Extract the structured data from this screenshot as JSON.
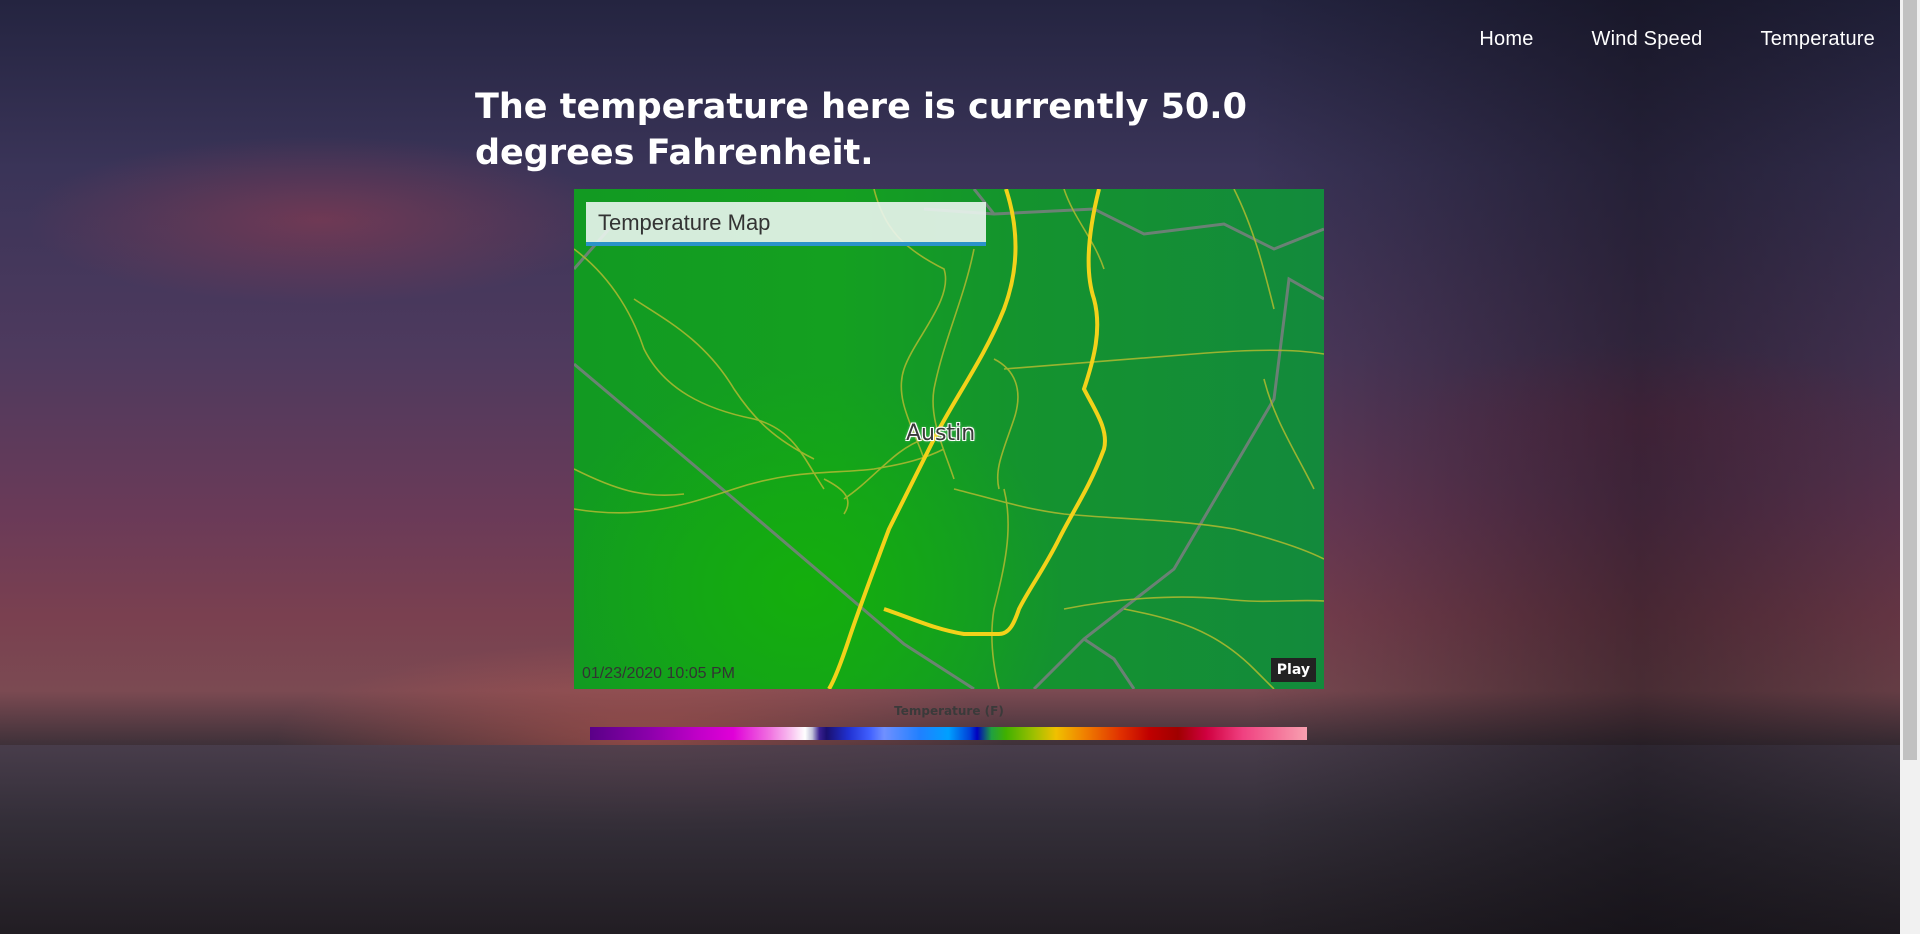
{
  "nav": {
    "items": [
      {
        "label": "Home"
      },
      {
        "label": "Wind Speed"
      },
      {
        "label": "Temperature"
      }
    ]
  },
  "headline": "The temperature here is currently 50.0 degrees Fahrenheit.",
  "map": {
    "title": "Temperature Map",
    "city_label": "Austin",
    "timestamp": "01/23/2020 10:05 PM",
    "play_label": "Play"
  },
  "legend": {
    "title": "Temperature (F)"
  }
}
